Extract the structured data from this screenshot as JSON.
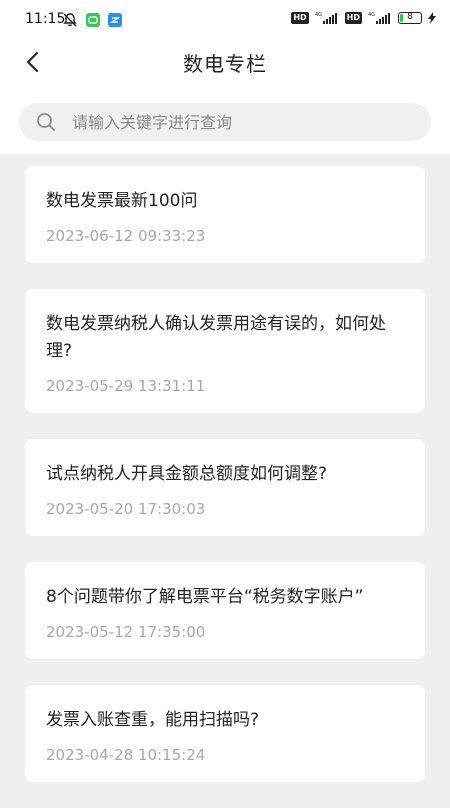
{
  "status_bar": {
    "time": "11:15",
    "network_1": "4G",
    "network_2": "4G",
    "hd_1": "HD",
    "hd_2": "HD",
    "battery": "8"
  },
  "header": {
    "title": "数电专栏"
  },
  "search": {
    "placeholder": "请输入关键字进行查询"
  },
  "articles": [
    {
      "title": "数电发票最新100问",
      "date": "2023-06-12 09:33:23"
    },
    {
      "title": "数电发票纳税人确认发票用途有误的，如何处理?",
      "date": "2023-05-29 13:31:11"
    },
    {
      "title": "试点纳税人开具金额总额度如何调整?",
      "date": "2023-05-20 17:30:03"
    },
    {
      "title": "8个问题带你了解电票平台“税务数字账户”",
      "date": "2023-05-12 17:35:00"
    },
    {
      "title": "发票入账查重，能用扫描吗?",
      "date": "2023-04-28 10:15:24"
    }
  ]
}
